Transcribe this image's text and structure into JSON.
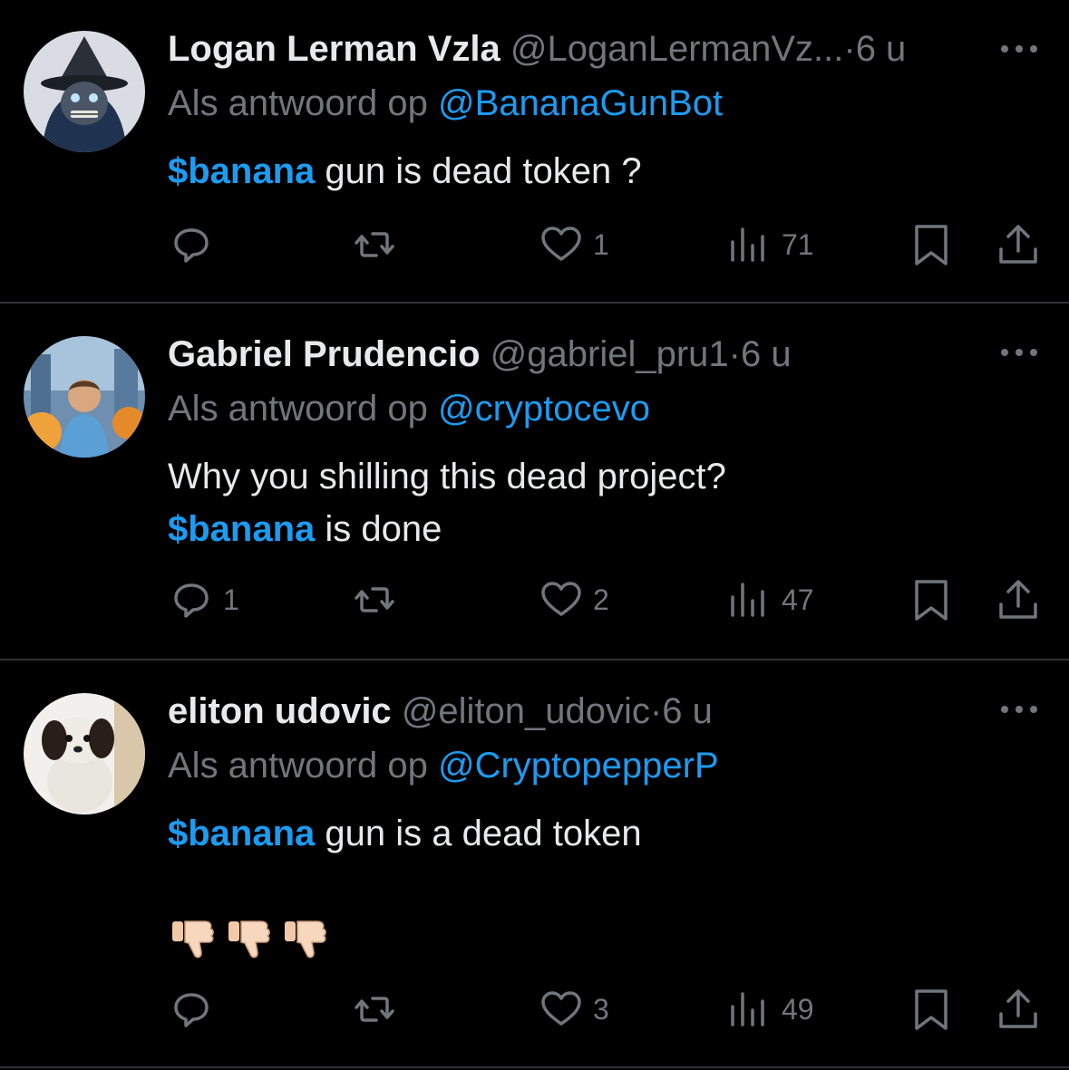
{
  "tweets": [
    {
      "name": "Logan Lerman Vzla",
      "handle": "@LoganLermanVz...",
      "dot": "·",
      "time": "6 u",
      "reply_prefix": "Als antwoord op",
      "reply_to": "@BananaGunBot",
      "cashtag": "$banana",
      "text": "gun is dead token ?",
      "replies": "",
      "likes": "1",
      "views": "71"
    },
    {
      "name": "Gabriel Prudencio",
      "handle": "@gabriel_pru1",
      "dot": "·",
      "time": "6 u",
      "reply_prefix": "Als antwoord op",
      "reply_to": "@cryptocevo",
      "text_line1": "Why you shilling this dead project?",
      "cashtag": "$banana",
      "text": "is done",
      "replies": "1",
      "likes": "2",
      "views": "47"
    },
    {
      "name": "eliton udovic",
      "handle": "@eliton_udovic",
      "dot": "·",
      "time": "6 u",
      "reply_prefix": "Als antwoord op",
      "reply_to": "@CryptopepperP",
      "cashtag": "$banana",
      "text": "gun is a dead token",
      "emoji": "👎🏻👎🏻👎🏻",
      "replies": "",
      "likes": "3",
      "views": "49"
    }
  ],
  "icons": {
    "reply": "reply-icon",
    "retweet": "retweet-icon",
    "like": "heart-icon",
    "views": "views-icon",
    "bookmark": "bookmark-icon",
    "share": "share-icon",
    "more": "more-icon"
  },
  "colors": {
    "background": "#000000",
    "text": "#e7e9ea",
    "muted": "#71767b",
    "accent": "#1d9bf0",
    "divider": "#2f3336"
  }
}
